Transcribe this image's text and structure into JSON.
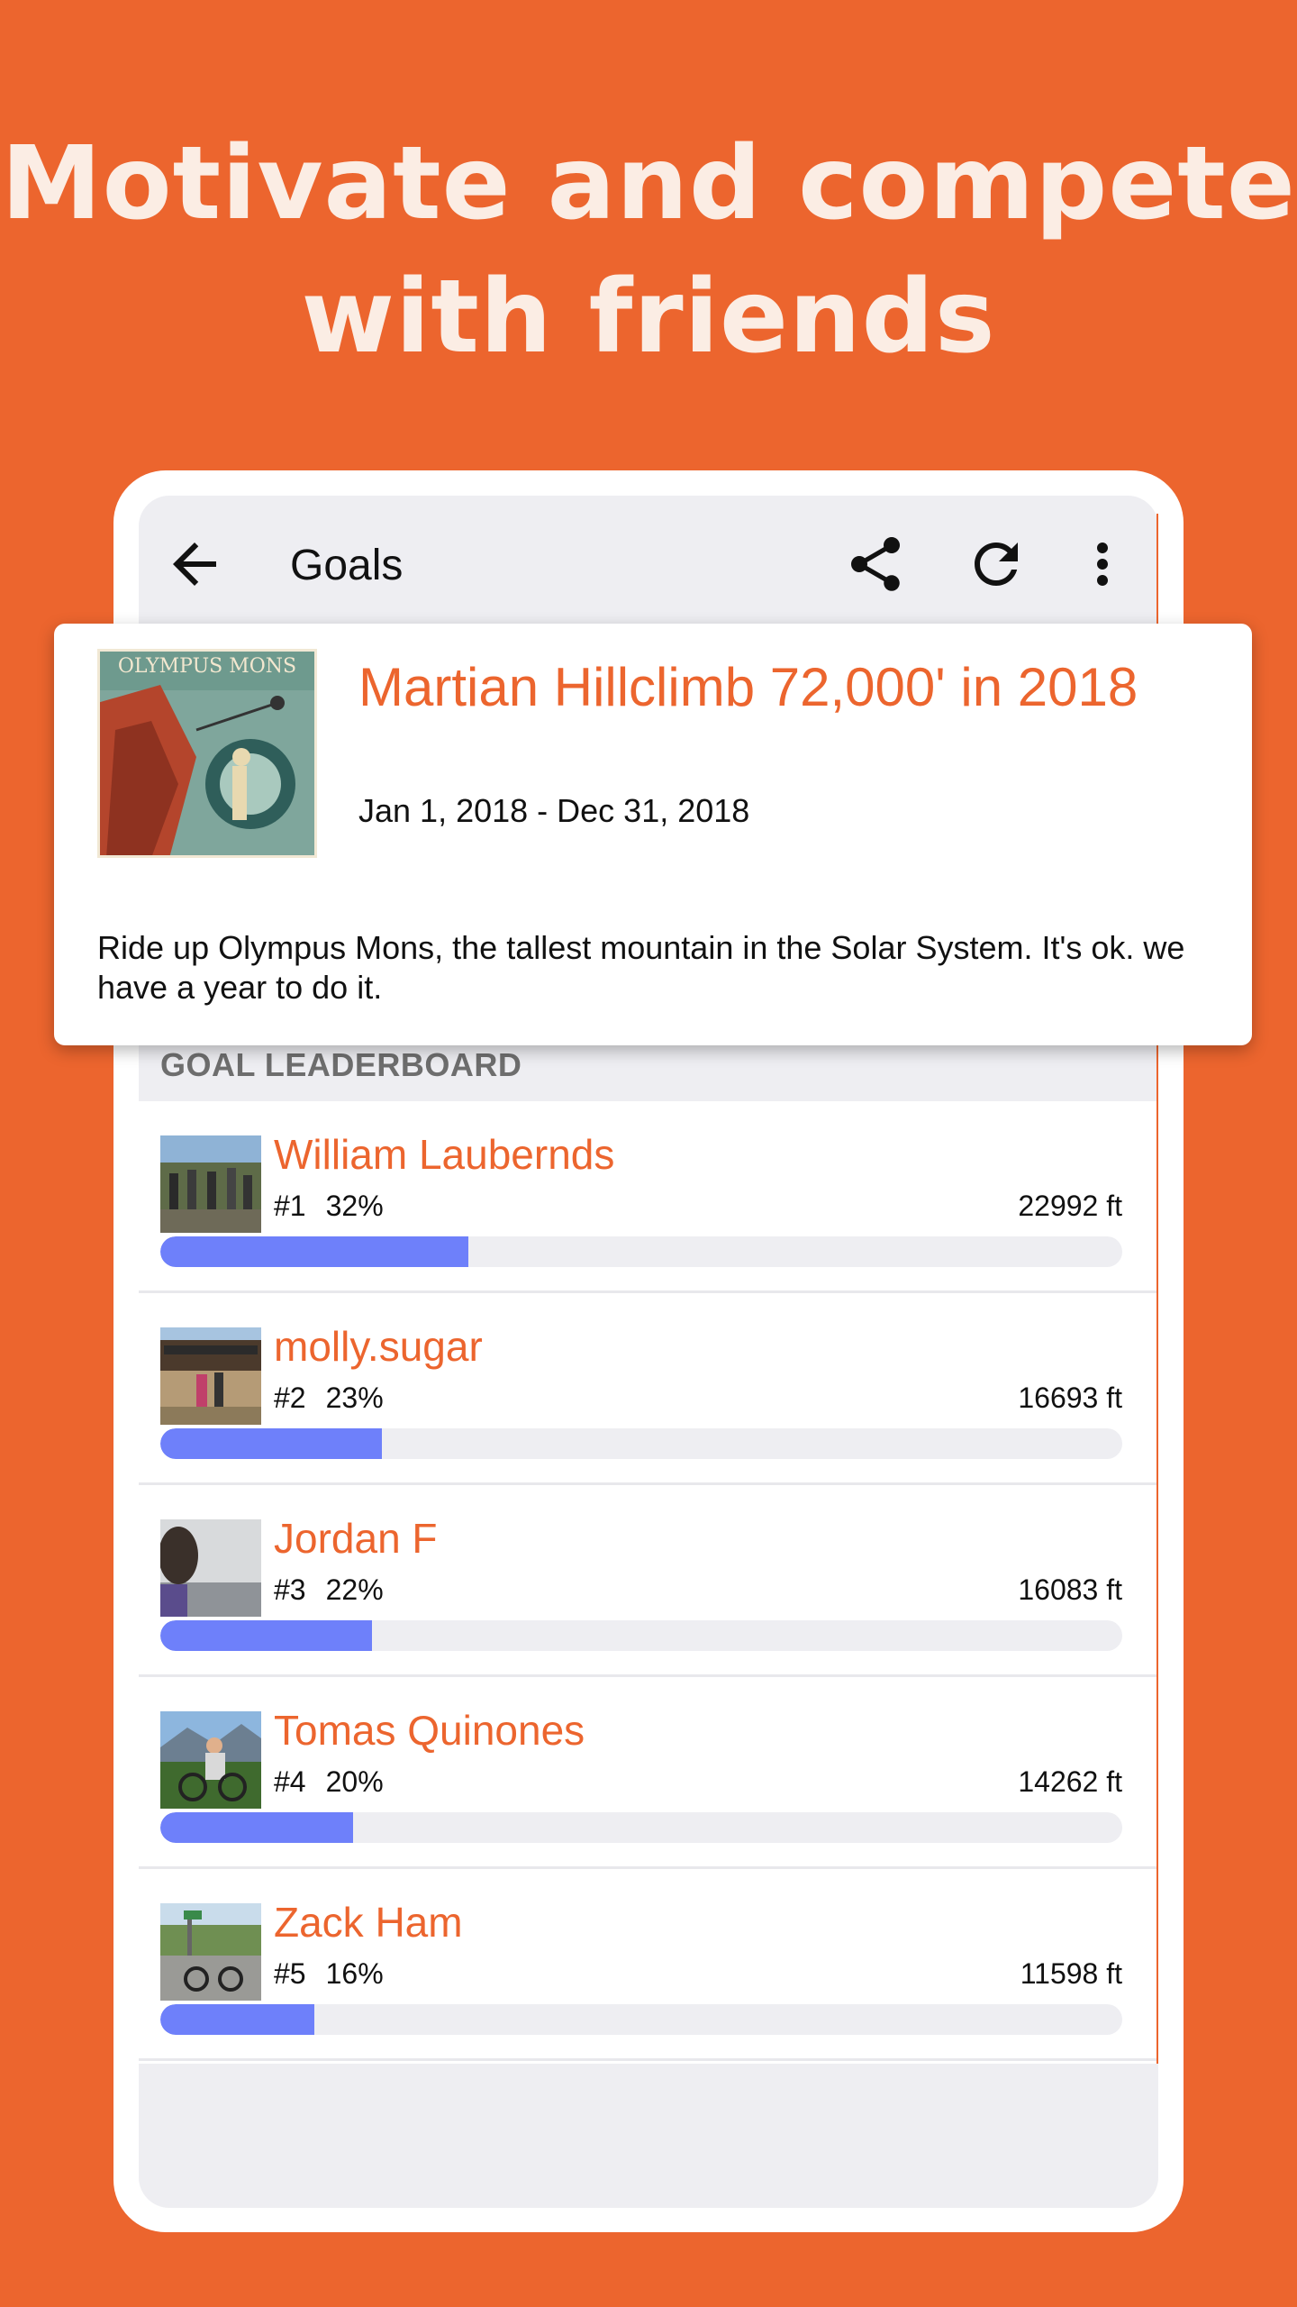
{
  "headline": {
    "line1": "Motivate and compete",
    "line2": "with friends"
  },
  "appbar": {
    "title": "Goals",
    "back_icon": "arrow-left-icon",
    "share_icon": "share-icon",
    "refresh_icon": "refresh-icon",
    "menu_icon": "more-vert-icon"
  },
  "goal": {
    "title": "Martian Hillclimb 72,000' in 2018",
    "dates": "Jan 1, 2018 - Dec 31, 2018",
    "description": "Ride up Olympus Mons, the tallest mountain in the Solar System. It's ok. we have a year to do it.",
    "poster_caption": "OLYMPUS MONS"
  },
  "leaderboard": {
    "header": "GOAL LEADERBOARD",
    "entries": [
      {
        "name": "William Laubernds",
        "rank": "#1",
        "percent": "32%",
        "progress": 0.32,
        "distance": "22992 ft"
      },
      {
        "name": "molly.sugar",
        "rank": "#2",
        "percent": "23%",
        "progress": 0.23,
        "distance": "16693 ft"
      },
      {
        "name": "Jordan F",
        "rank": "#3",
        "percent": "22%",
        "progress": 0.22,
        "distance": "16083 ft"
      },
      {
        "name": "Tomas Quinones",
        "rank": "#4",
        "percent": "20%",
        "progress": 0.2,
        "distance": "14262 ft"
      },
      {
        "name": "Zack Ham",
        "rank": "#5",
        "percent": "16%",
        "progress": 0.16,
        "distance": "11598 ft"
      }
    ]
  },
  "colors": {
    "brand": "#EC652E",
    "progress": "#6E80FA",
    "track": "#EEEEF2"
  }
}
